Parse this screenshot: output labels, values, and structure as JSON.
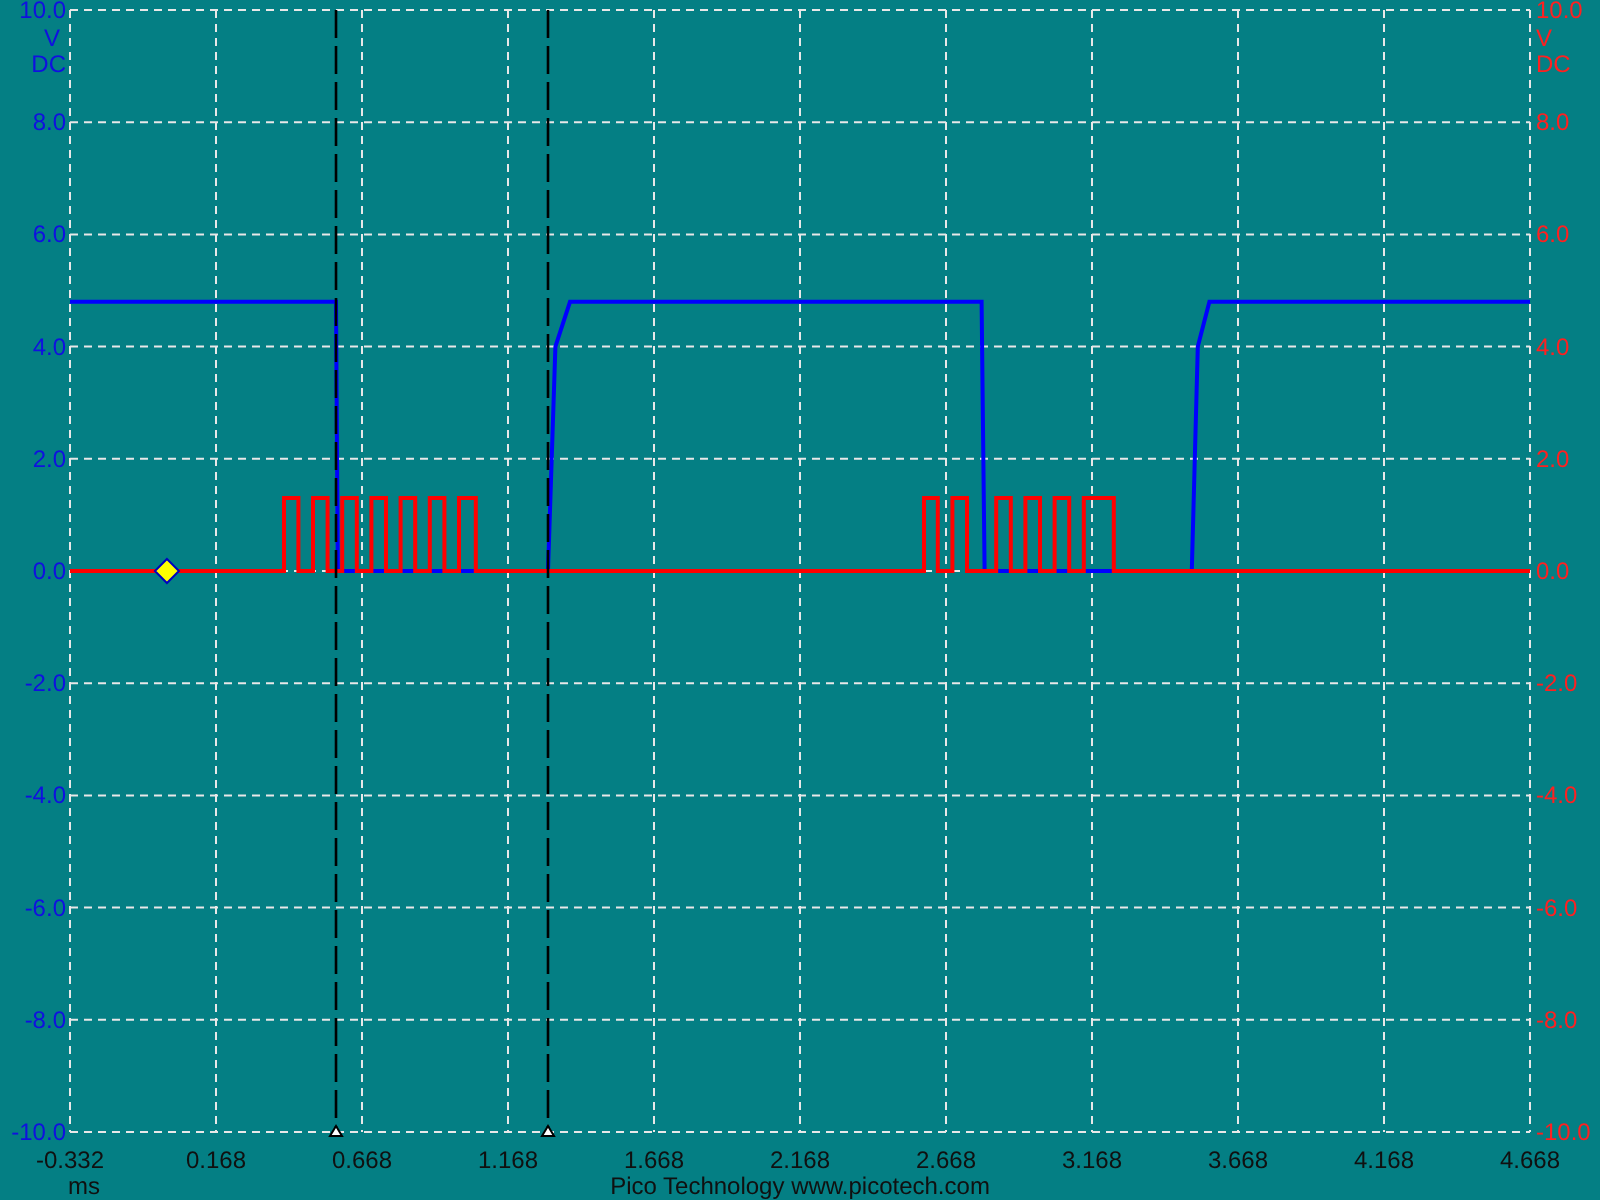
{
  "chart": {
    "chart_data": {
      "type": "line",
      "xlim": [
        -0.332,
        4.668
      ],
      "ylim": [
        -10,
        10
      ],
      "xticks": [
        {
          "value": -0.332,
          "label": "-0.332"
        },
        {
          "value": 0.168,
          "label": "0.168"
        },
        {
          "value": 0.668,
          "label": "0.668"
        },
        {
          "value": 1.168,
          "label": "1.168"
        },
        {
          "value": 1.668,
          "label": "1.668"
        },
        {
          "value": 2.168,
          "label": "2.168"
        },
        {
          "value": 2.668,
          "label": "2.668"
        },
        {
          "value": 3.168,
          "label": "3.168"
        },
        {
          "value": 3.668,
          "label": "3.668"
        },
        {
          "value": 4.168,
          "label": "4.168"
        },
        {
          "value": 4.668,
          "label": "4.668"
        }
      ],
      "yticks": [
        {
          "value": 10,
          "label": "10.0"
        },
        {
          "value": 8,
          "label": "8.0"
        },
        {
          "value": 6,
          "label": "6.0"
        },
        {
          "value": 4,
          "label": "4.0"
        },
        {
          "value": 2,
          "label": "2.0"
        },
        {
          "value": 0,
          "label": "0.0"
        },
        {
          "value": -2,
          "label": "-2.0"
        },
        {
          "value": -4,
          "label": "-4.0"
        },
        {
          "value": -6,
          "label": "-6.0"
        },
        {
          "value": -8,
          "label": "-8.0"
        },
        {
          "value": -10,
          "label": "-10.0"
        }
      ],
      "x": [
        -0.332,
        0.401,
        0.401,
        0.45,
        0.45,
        0.5,
        0.5,
        0.55,
        0.55,
        0.579,
        0.585,
        0.6,
        0.6,
        0.65,
        0.65,
        0.7,
        0.7,
        0.75,
        0.75,
        0.8,
        0.8,
        0.85,
        0.85,
        0.9,
        0.9,
        0.95,
        0.95,
        1.0,
        1.0,
        1.058,
        1.058,
        1.305,
        1.33,
        1.38,
        2.593,
        2.593,
        2.64,
        2.64,
        2.69,
        2.69,
        2.74,
        2.74,
        2.79,
        2.8,
        2.84,
        2.84,
        2.89,
        2.89,
        2.94,
        2.94,
        2.99,
        2.99,
        3.04,
        3.04,
        3.09,
        3.09,
        3.14,
        3.14,
        3.243,
        3.243,
        3.51,
        3.53,
        3.57,
        4.668
      ],
      "series": [
        {
          "color": "#0000ff",
          "values": [
            4.8,
            4.8,
            4.8,
            4.8,
            4.8,
            4.8,
            4.8,
            4.8,
            4.8,
            4.8,
            0,
            0,
            0,
            0,
            0,
            0,
            0,
            0,
            0,
            0,
            0,
            0,
            0,
            0,
            0,
            0,
            0,
            0,
            0,
            0,
            0,
            0,
            4.0,
            4.8,
            4.8,
            4.8,
            4.8,
            4.8,
            4.8,
            4.8,
            4.8,
            4.8,
            4.8,
            0,
            0,
            0,
            0,
            0,
            0,
            0,
            0,
            0,
            0,
            0,
            0,
            0,
            0,
            0,
            0,
            0,
            0,
            4.0,
            4.8,
            4.8
          ]
        },
        {
          "color": "#ff0000",
          "values": [
            0,
            0,
            1.3,
            1.3,
            0,
            0,
            1.3,
            1.3,
            0,
            0,
            0,
            0,
            1.3,
            1.3,
            0,
            0,
            1.3,
            1.3,
            0,
            0,
            1.3,
            1.3,
            0,
            0,
            1.3,
            1.3,
            0,
            0,
            1.3,
            1.3,
            0,
            0,
            0,
            0,
            0,
            1.3,
            1.3,
            0,
            0,
            1.3,
            1.3,
            0,
            0,
            0,
            0,
            1.3,
            1.3,
            0,
            0,
            1.3,
            1.3,
            0,
            0,
            1.3,
            1.3,
            0,
            0,
            1.3,
            1.3,
            0,
            0,
            0,
            0,
            0
          ]
        }
      ],
      "grid": true,
      "ref_lines": [
        {
          "axis": "x",
          "value": 0.579
        },
        {
          "axis": "x",
          "value": 1.305
        }
      ]
    }
  },
  "left_axis": {
    "unit": "V",
    "coupling": "DC"
  },
  "right_axis": {
    "unit": "V",
    "coupling": "DC",
    "ticks": [
      "10.0",
      "8.0",
      "6.0",
      "4.0",
      "2.0",
      "0.0",
      "-2.0",
      "-4.0",
      "-6.0",
      "-8.0",
      "-10.0"
    ]
  },
  "x_unit": "ms",
  "footer": "Pico Technology  www.picotech.com"
}
